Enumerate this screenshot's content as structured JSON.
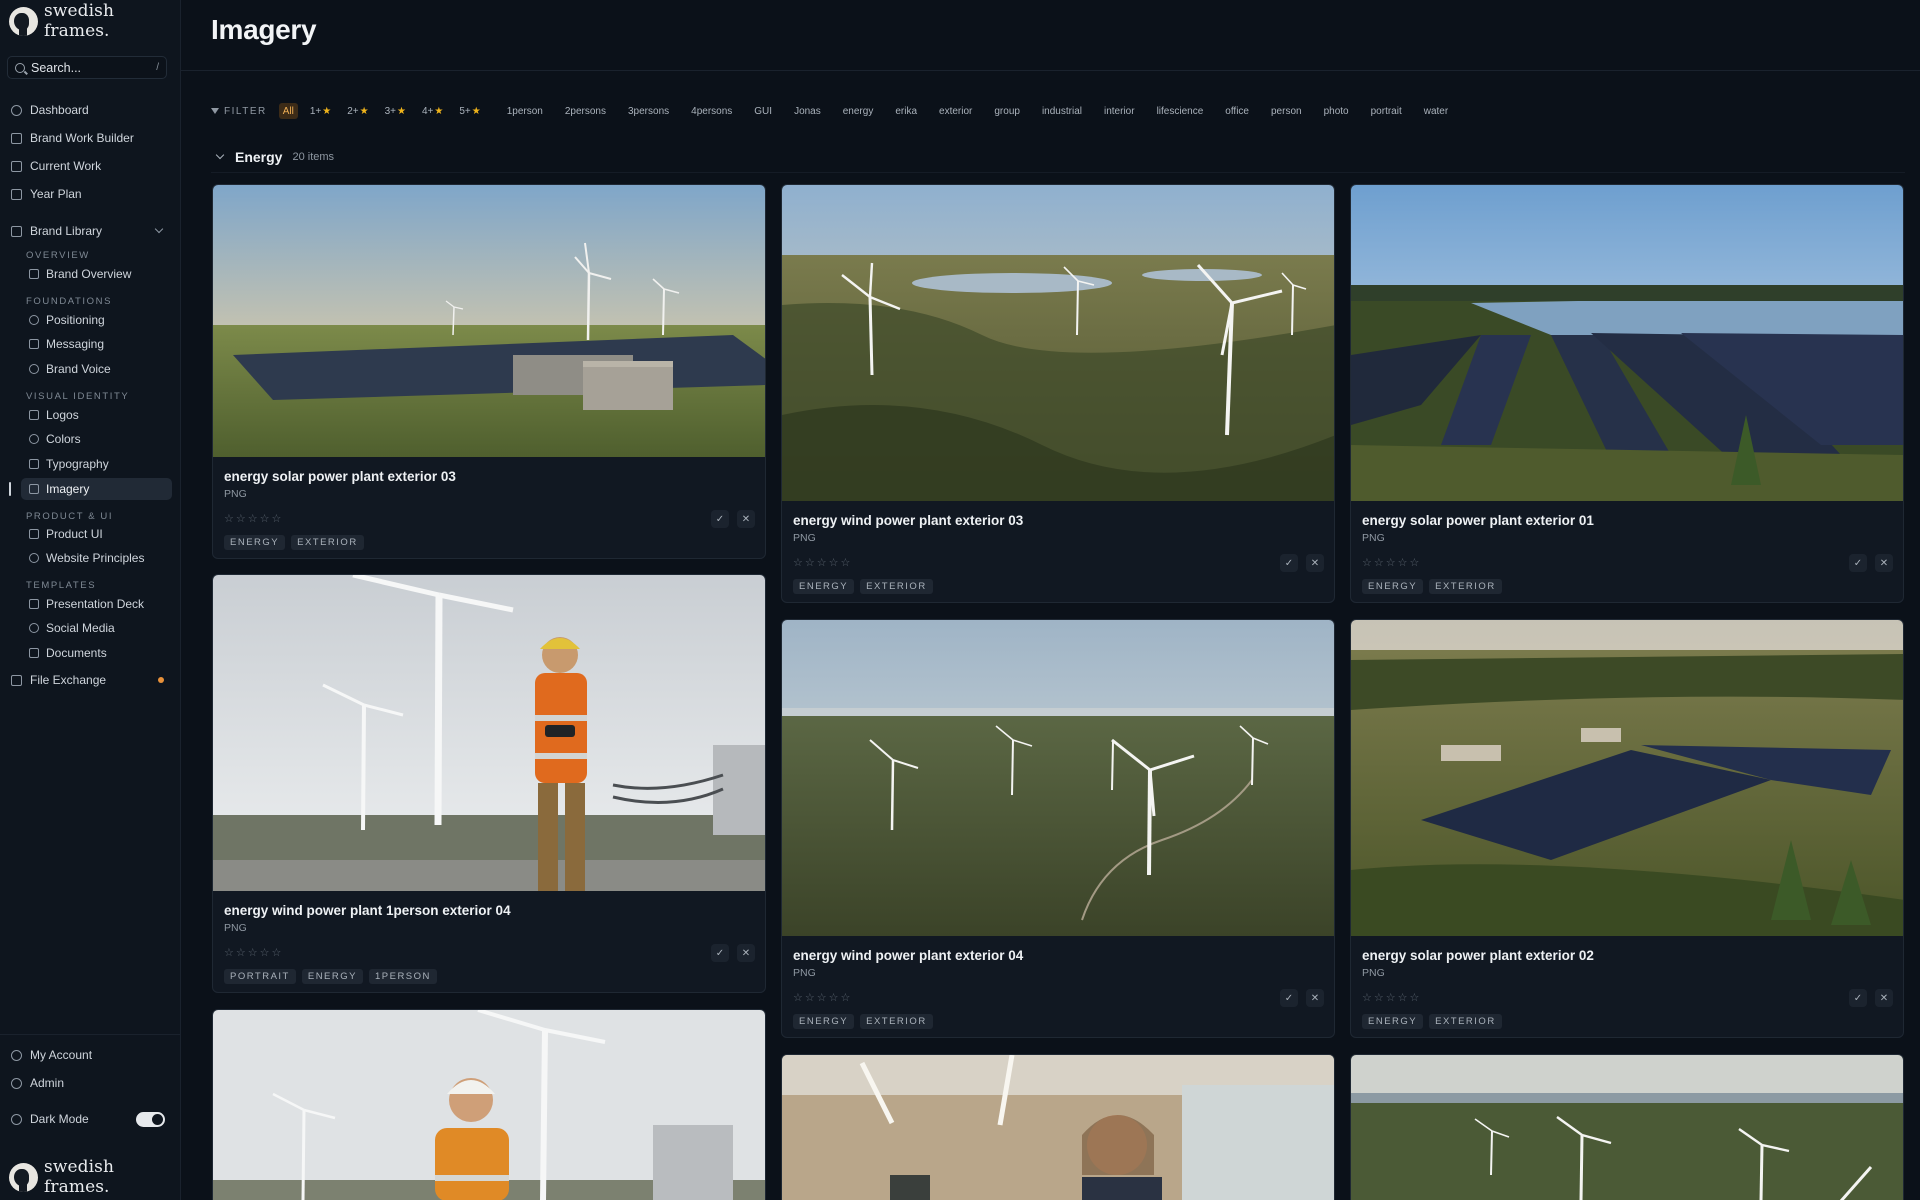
{
  "brand": {
    "name": "swedish frames."
  },
  "search": {
    "placeholder": "Search...",
    "shortcut": "/"
  },
  "nav": {
    "dashboard": "Dashboard",
    "brand_work_builder": "Brand Work Builder",
    "current_work": "Current Work",
    "year_plan": "Year Plan",
    "brand_library": "Brand Library",
    "file_exchange": "File Exchange"
  },
  "library": {
    "overview_label": "OVERVIEW",
    "brand_overview": "Brand Overview",
    "foundations_label": "FOUNDATIONS",
    "positioning": "Positioning",
    "messaging": "Messaging",
    "brand_voice": "Brand Voice",
    "visual_identity_label": "VISUAL IDENTITY",
    "logos": "Logos",
    "colors": "Colors",
    "typography": "Typography",
    "imagery": "Imagery",
    "product_ui_label": "PRODUCT & UI",
    "product_ui": "Product UI",
    "website_principles": "Website Principles",
    "templates_label": "TEMPLATES",
    "presentation_deck": "Presentation Deck",
    "social_media": "Social Media",
    "documents": "Documents"
  },
  "bottom": {
    "my_account": "My Account",
    "admin": "Admin",
    "dark_mode": "Dark Mode",
    "dark_mode_on": true
  },
  "page": {
    "title": "Imagery"
  },
  "filter": {
    "label": "FILTER",
    "all": "All",
    "ratings": [
      "1+",
      "2+",
      "3+",
      "4+",
      "5+"
    ],
    "tags": [
      "1person",
      "2persons",
      "3persons",
      "4persons",
      "GUI",
      "Jonas",
      "energy",
      "erika",
      "exterior",
      "group",
      "industrial",
      "interior",
      "lifescience",
      "office",
      "person",
      "photo",
      "portrait",
      "water"
    ]
  },
  "group": {
    "name": "Energy",
    "count": "20 items"
  },
  "cards": [
    {
      "title": "energy solar power plant exterior 03",
      "type": "PNG",
      "tags": [
        "ENERGY",
        "EXTERIOR"
      ]
    },
    {
      "title": "energy wind power plant exterior 03",
      "type": "PNG",
      "tags": [
        "ENERGY",
        "EXTERIOR"
      ]
    },
    {
      "title": "energy solar power plant exterior 01",
      "type": "PNG",
      "tags": [
        "ENERGY",
        "EXTERIOR"
      ]
    },
    {
      "title": "energy wind power plant 1person exterior 04",
      "type": "PNG",
      "tags": [
        "PORTRAIT",
        "ENERGY",
        "1PERSON"
      ]
    },
    {
      "title": "energy wind power plant exterior 04",
      "type": "PNG",
      "tags": [
        "ENERGY",
        "EXTERIOR"
      ]
    },
    {
      "title": "energy solar power plant exterior 02",
      "type": "PNG",
      "tags": [
        "ENERGY",
        "EXTERIOR"
      ]
    }
  ],
  "rating_glyph": "☆",
  "icons": {
    "approve": "check-icon",
    "reject": "close-icon"
  },
  "colors": {
    "accent": "#f0b056",
    "star": "#f0b41b",
    "notification": "#e8913a"
  }
}
